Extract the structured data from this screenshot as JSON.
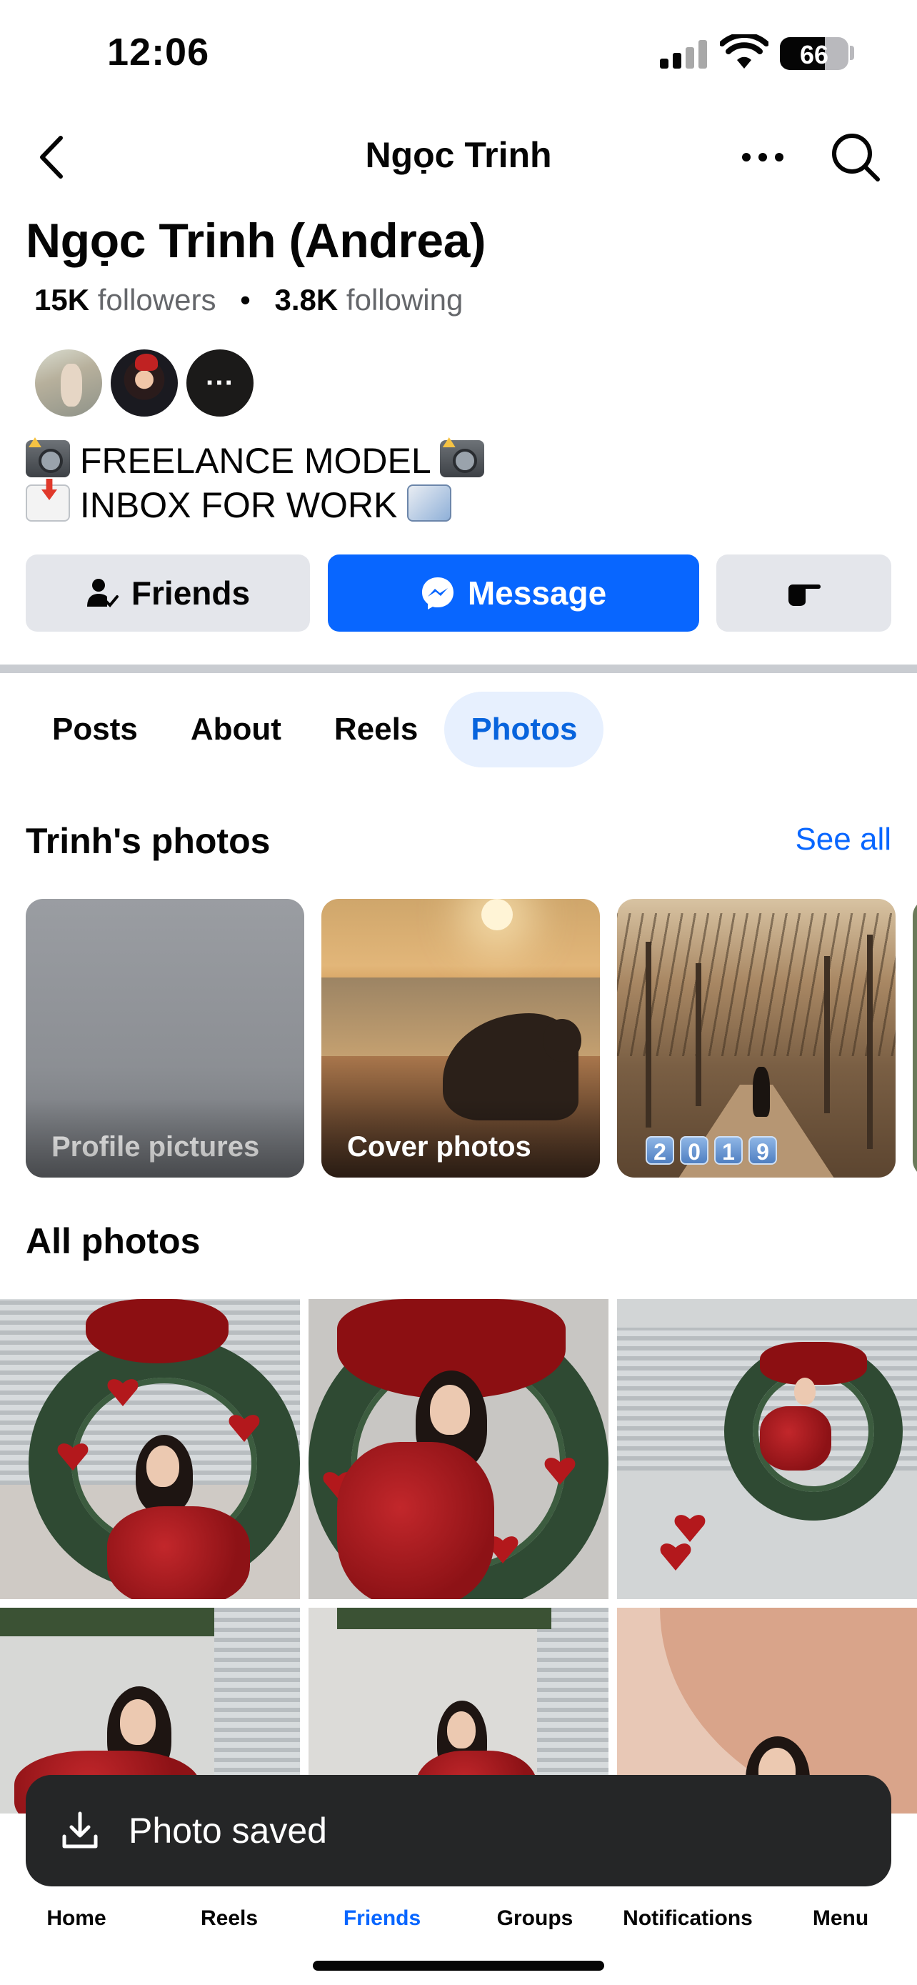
{
  "status_bar": {
    "time": "12:06",
    "battery": "66",
    "battery_level": 0.66
  },
  "header": {
    "title": "Ngọc Trinh"
  },
  "profile": {
    "name": "Ngọc Trinh (Andrea)",
    "followers_count": "15K",
    "followers_label": "followers",
    "following_count": "3.8K",
    "following_label": "following",
    "mutual_more": "···",
    "bio_line1": "FREELANCE MODEL",
    "bio_line2": "INBOX FOR WORK"
  },
  "actions": {
    "friends": "Friends",
    "message": "Message"
  },
  "tabs": [
    {
      "label": "Posts"
    },
    {
      "label": "About"
    },
    {
      "label": "Reels"
    },
    {
      "label": "Photos",
      "active": true
    }
  ],
  "photos_section": {
    "title": "Trinh's photos",
    "see_all": "See all",
    "albums": [
      {
        "label": "Profile pictures"
      },
      {
        "label": "Cover photos"
      },
      {
        "label": ""
      }
    ],
    "album3_digits": [
      "2",
      "0",
      "1",
      "9"
    ],
    "all_photos_title": "All photos"
  },
  "toast": {
    "text": "Photo saved"
  },
  "bottom_nav": [
    {
      "label": "Home",
      "icon": "home-icon"
    },
    {
      "label": "Reels",
      "icon": "reels-icon"
    },
    {
      "label": "Friends",
      "icon": "friends-icon",
      "active": true
    },
    {
      "label": "Groups",
      "icon": "groups-icon"
    },
    {
      "label": "Notifications",
      "icon": "bell-icon"
    },
    {
      "label": "Menu",
      "icon": "menu-icon"
    }
  ],
  "colors": {
    "accent": "#0866ff",
    "active_tab_bg": "#e7f0fe",
    "button_gray": "#e4e6eb",
    "toast_bg": "#252627"
  }
}
